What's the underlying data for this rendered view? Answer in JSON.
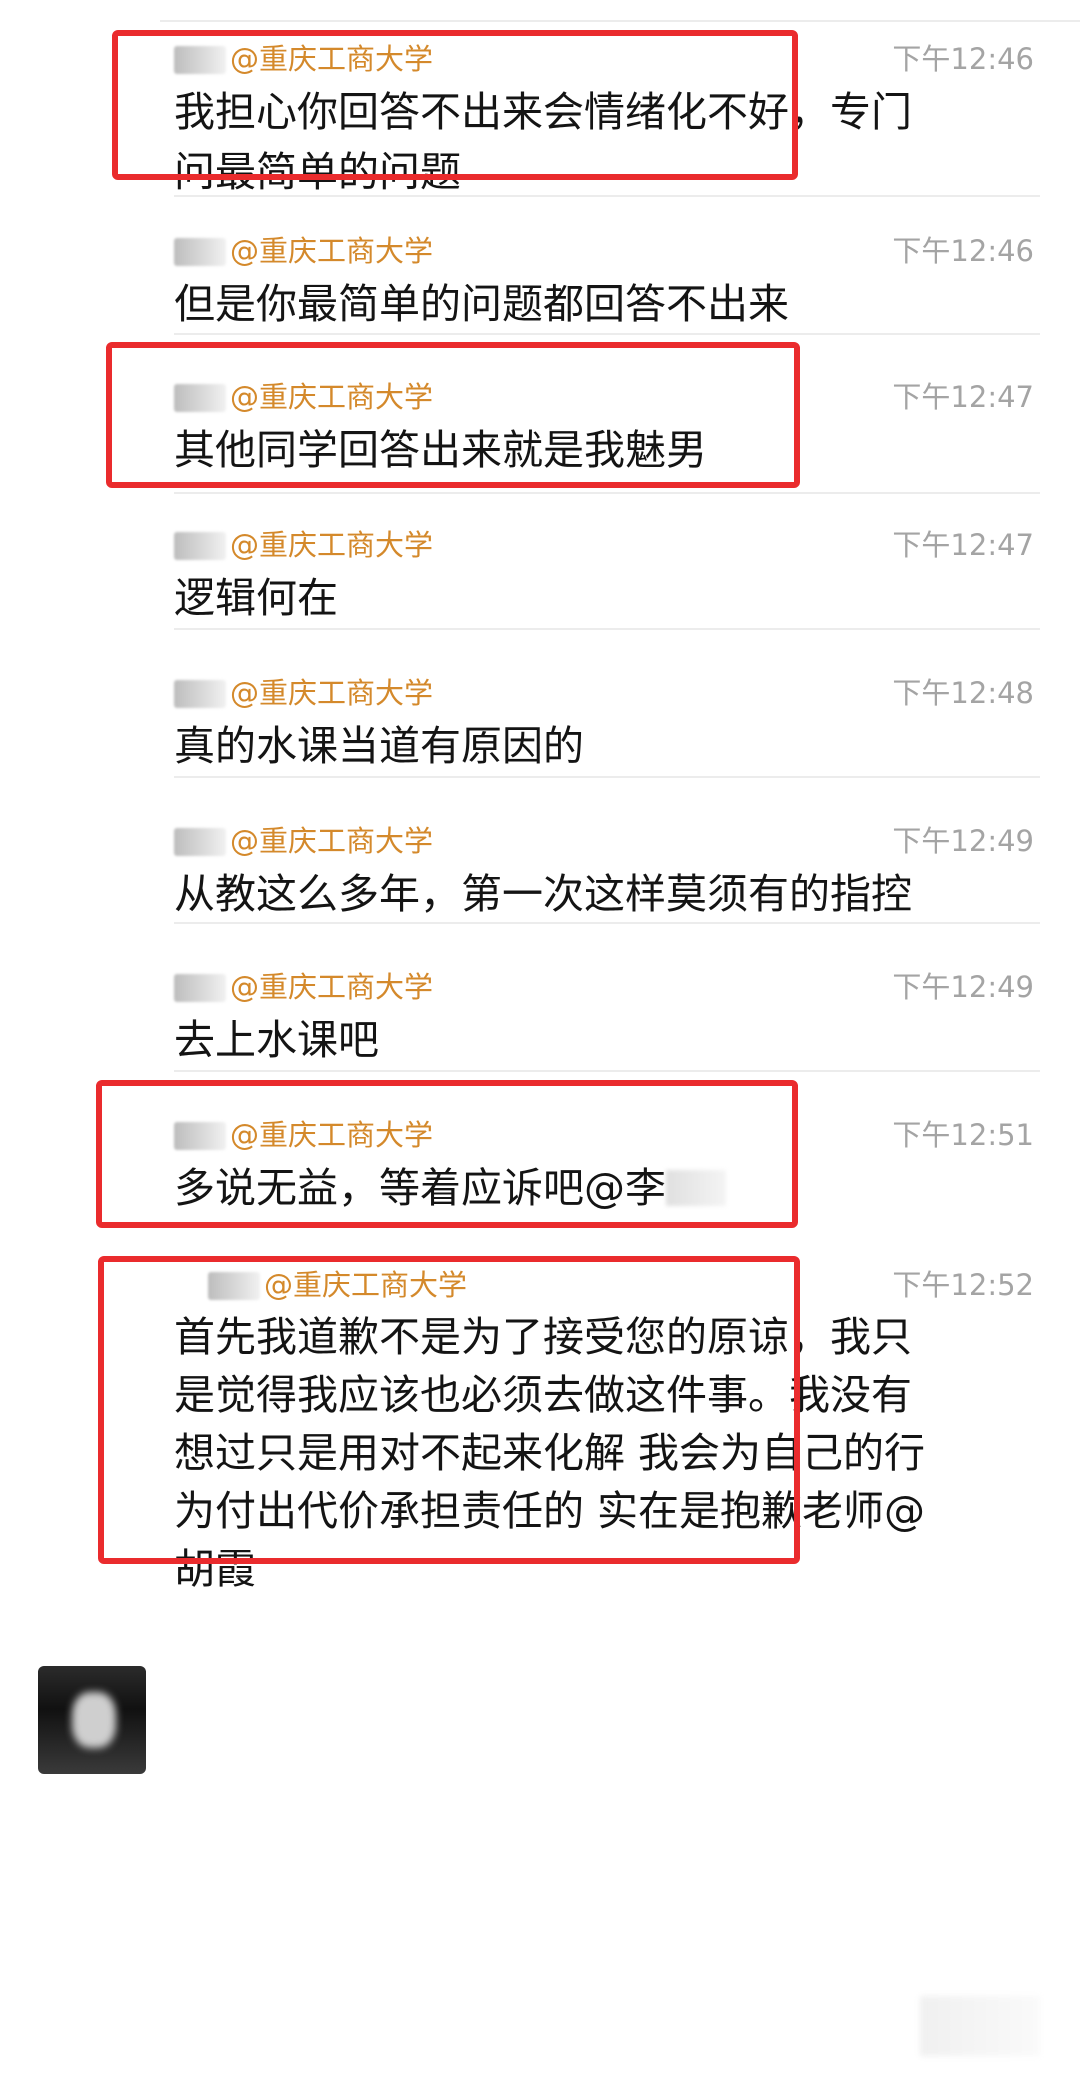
{
  "messages": [
    {
      "sender": "@重庆工商大学",
      "time": "下午12:46",
      "text_lines": [
        "我担心你回答不出来会情绪化不好，专门",
        "问最简单的问题"
      ],
      "highlighted": true
    },
    {
      "sender": "@重庆工商大学",
      "time": "下午12:46",
      "text_lines": [
        "但是你最简单的问题都回答不出来"
      ],
      "highlighted": false
    },
    {
      "sender": "@重庆工商大学",
      "time": "下午12:47",
      "text_lines": [
        "其他同学回答出来就是我魅男"
      ],
      "highlighted": true
    },
    {
      "sender": "@重庆工商大学",
      "time": "下午12:47",
      "text_lines": [
        "逻辑何在"
      ],
      "highlighted": false
    },
    {
      "sender": "@重庆工商大学",
      "time": "下午12:48",
      "text_lines": [
        "真的水课当道有原因的"
      ],
      "highlighted": false
    },
    {
      "sender": "@重庆工商大学",
      "time": "下午12:49",
      "text_lines": [
        "从教这么多年，第一次这样莫须有的指控"
      ],
      "highlighted": false
    },
    {
      "sender": "@重庆工商大学",
      "time": "下午12:49",
      "text_lines": [
        "去上水课吧"
      ],
      "highlighted": false
    },
    {
      "sender": "@重庆工商大学",
      "time": "下午12:51",
      "text_lines": [
        "多说无益，等着应诉吧@李"
      ],
      "highlighted": true
    },
    {
      "sender": "@重庆工商大学",
      "time": "下午12:52",
      "text_lines": [
        "首先我道歉不是为了接受您的原谅，我只",
        "是觉得我应该也必须去做这件事。我没有",
        "想过只是用对不起来化解 我会为自己的行",
        "为付出代价承担责任的 实在是抱歉老师@",
        "胡霞"
      ],
      "highlighted": true
    }
  ],
  "colors": {
    "highlight": "#ea2b2d",
    "sender": "#d4892b",
    "time": "#a4a4a4"
  },
  "icons": {
    "avatar": "user-avatar-blurred"
  }
}
